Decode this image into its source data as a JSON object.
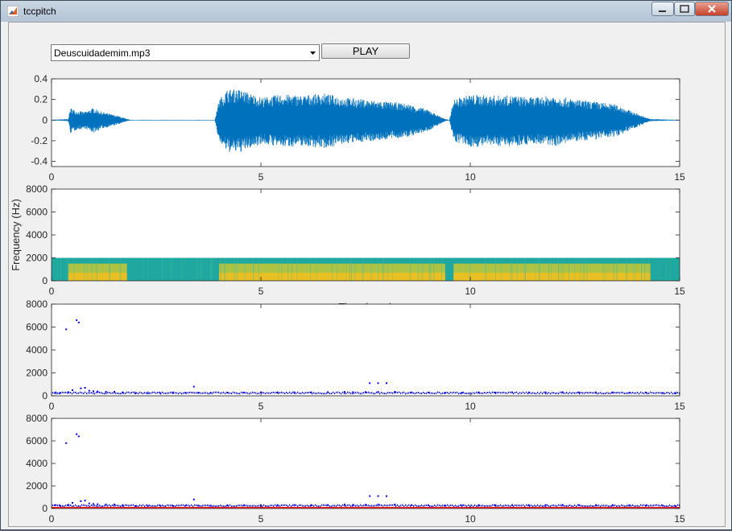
{
  "window": {
    "title": "tccpitch"
  },
  "controls": {
    "file_selected": "Deuscuidademim.mp3",
    "play_label": "PLAY"
  },
  "colors": {
    "waveform": "#0072bd",
    "pitch": "#0000ff",
    "pitch_ref": "#ff0000"
  },
  "chart_data": [
    {
      "type": "line",
      "name": "waveform",
      "xlim": [
        0,
        15
      ],
      "ylim": [
        -0.45,
        0.4
      ],
      "xticks": [
        0,
        5,
        10,
        15
      ],
      "yticks": [
        -0.4,
        -0.2,
        0,
        0.2,
        0.4
      ],
      "ytick_labels": [
        "-0.4",
        "-0.2",
        "0",
        "0.2",
        "0.4"
      ],
      "envelope": [
        [
          0.0,
          0.003
        ],
        [
          0.4,
          0.01
        ],
        [
          0.45,
          0.12
        ],
        [
          0.6,
          0.09
        ],
        [
          0.8,
          0.08
        ],
        [
          1.0,
          0.12
        ],
        [
          1.2,
          0.08
        ],
        [
          1.4,
          0.06
        ],
        [
          1.6,
          0.04
        ],
        [
          1.8,
          0.01
        ],
        [
          1.9,
          0.003
        ],
        [
          3.9,
          0.003
        ],
        [
          4.0,
          0.2
        ],
        [
          4.2,
          0.3
        ],
        [
          4.5,
          0.3
        ],
        [
          5.0,
          0.22
        ],
        [
          5.5,
          0.25
        ],
        [
          6.0,
          0.24
        ],
        [
          6.5,
          0.26
        ],
        [
          7.0,
          0.22
        ],
        [
          7.5,
          0.2
        ],
        [
          8.0,
          0.18
        ],
        [
          8.5,
          0.16
        ],
        [
          9.0,
          0.1
        ],
        [
          9.4,
          0.01
        ],
        [
          9.5,
          0.003
        ],
        [
          9.6,
          0.2
        ],
        [
          10.0,
          0.25
        ],
        [
          10.5,
          0.24
        ],
        [
          11.0,
          0.24
        ],
        [
          11.5,
          0.22
        ],
        [
          12.0,
          0.24
        ],
        [
          12.5,
          0.2
        ],
        [
          13.0,
          0.18
        ],
        [
          13.5,
          0.15
        ],
        [
          14.0,
          0.06
        ],
        [
          14.3,
          0.01
        ],
        [
          15.0,
          0.003
        ]
      ]
    },
    {
      "type": "heatmap",
      "name": "spectrogram",
      "xlim": [
        0,
        15
      ],
      "ylim": [
        0,
        8000
      ],
      "xticks": [
        0,
        5,
        10,
        15
      ],
      "yticks": [
        0,
        2000,
        4000,
        6000,
        8000
      ],
      "ytick_labels": [
        "0",
        "2000",
        "4000",
        "6000",
        "8000"
      ],
      "ylabel": "Frequency (Hz)",
      "xlabel": "Time (secs)",
      "band_max_hz": 2000,
      "segments_active": [
        [
          0.4,
          1.8
        ],
        [
          4.0,
          9.4
        ],
        [
          9.6,
          14.3
        ]
      ]
    },
    {
      "type": "scatter",
      "name": "pitch",
      "xlim": [
        0,
        15
      ],
      "ylim": [
        0,
        8000
      ],
      "xticks": [
        0,
        5,
        10,
        15
      ],
      "yticks": [
        0,
        2000,
        4000,
        6000,
        8000
      ],
      "ytick_labels": [
        "0",
        "2000",
        "4000",
        "6000",
        "8000"
      ],
      "points": [
        [
          0.35,
          5800
        ],
        [
          0.6,
          6600
        ],
        [
          0.65,
          6400
        ],
        [
          3.4,
          800
        ],
        [
          7.6,
          1100
        ],
        [
          7.8,
          1100
        ],
        [
          8.0,
          1100
        ],
        [
          0.1,
          300
        ],
        [
          0.2,
          250
        ],
        [
          0.4,
          320
        ],
        [
          0.5,
          500
        ],
        [
          0.7,
          650
        ],
        [
          0.8,
          700
        ],
        [
          0.9,
          450
        ],
        [
          1.0,
          400
        ],
        [
          1.1,
          380
        ],
        [
          1.3,
          350
        ],
        [
          1.5,
          360
        ],
        [
          1.7,
          300
        ],
        [
          2.0,
          220
        ],
        [
          2.3,
          220
        ],
        [
          2.6,
          240
        ],
        [
          2.9,
          230
        ],
        [
          3.2,
          250
        ],
        [
          3.5,
          260
        ],
        [
          3.8,
          250
        ],
        [
          4.2,
          280
        ],
        [
          4.6,
          290
        ],
        [
          5.0,
          300
        ],
        [
          5.4,
          300
        ],
        [
          5.8,
          310
        ],
        [
          6.2,
          300
        ],
        [
          6.6,
          320
        ],
        [
          7.0,
          340
        ],
        [
          7.2,
          320
        ],
        [
          7.5,
          330
        ],
        [
          7.8,
          340
        ],
        [
          8.2,
          350
        ],
        [
          8.6,
          300
        ],
        [
          9.0,
          280
        ],
        [
          9.4,
          260
        ],
        [
          9.8,
          280
        ],
        [
          10.2,
          300
        ],
        [
          10.6,
          290
        ],
        [
          11.0,
          300
        ],
        [
          11.4,
          300
        ],
        [
          11.8,
          310
        ],
        [
          12.2,
          320
        ],
        [
          12.6,
          300
        ],
        [
          13.0,
          300
        ],
        [
          13.4,
          300
        ],
        [
          13.8,
          290
        ],
        [
          14.2,
          280
        ],
        [
          14.6,
          260
        ],
        [
          14.9,
          200
        ]
      ],
      "baseline": 250
    },
    {
      "type": "scatter",
      "name": "pitch-with-reference",
      "xlim": [
        0,
        15
      ],
      "ylim": [
        0,
        8000
      ],
      "xticks": [
        0,
        5,
        10,
        15
      ],
      "yticks": [
        0,
        2000,
        4000,
        6000,
        8000
      ],
      "ytick_labels": [
        "0",
        "2000",
        "4000",
        "6000",
        "8000"
      ],
      "points": [
        [
          0.35,
          5800
        ],
        [
          0.6,
          6600
        ],
        [
          0.65,
          6400
        ],
        [
          3.4,
          800
        ],
        [
          7.6,
          1100
        ],
        [
          7.8,
          1100
        ],
        [
          8.0,
          1100
        ],
        [
          0.1,
          300
        ],
        [
          0.2,
          250
        ],
        [
          0.4,
          320
        ],
        [
          0.5,
          500
        ],
        [
          0.7,
          650
        ],
        [
          0.8,
          700
        ],
        [
          0.9,
          450
        ],
        [
          1.0,
          400
        ],
        [
          1.1,
          380
        ],
        [
          1.3,
          350
        ],
        [
          1.5,
          360
        ],
        [
          1.7,
          300
        ],
        [
          2.0,
          220
        ],
        [
          2.3,
          220
        ],
        [
          2.6,
          240
        ],
        [
          2.9,
          230
        ],
        [
          3.2,
          250
        ],
        [
          3.5,
          260
        ],
        [
          3.8,
          250
        ],
        [
          4.2,
          280
        ],
        [
          4.6,
          290
        ],
        [
          5.0,
          300
        ],
        [
          5.4,
          300
        ],
        [
          5.8,
          310
        ],
        [
          6.2,
          300
        ],
        [
          6.6,
          320
        ],
        [
          7.0,
          340
        ],
        [
          7.2,
          320
        ],
        [
          7.5,
          330
        ],
        [
          7.8,
          340
        ],
        [
          8.2,
          350
        ],
        [
          8.6,
          300
        ],
        [
          9.0,
          280
        ],
        [
          9.4,
          260
        ],
        [
          9.8,
          280
        ],
        [
          10.2,
          300
        ],
        [
          10.6,
          290
        ],
        [
          11.0,
          300
        ],
        [
          11.4,
          300
        ],
        [
          11.8,
          310
        ],
        [
          12.2,
          320
        ],
        [
          12.6,
          300
        ],
        [
          13.0,
          300
        ],
        [
          13.4,
          300
        ],
        [
          13.8,
          290
        ],
        [
          14.2,
          280
        ],
        [
          14.6,
          260
        ],
        [
          14.9,
          200
        ]
      ],
      "baseline": 250,
      "reference_baseline": 80
    }
  ]
}
